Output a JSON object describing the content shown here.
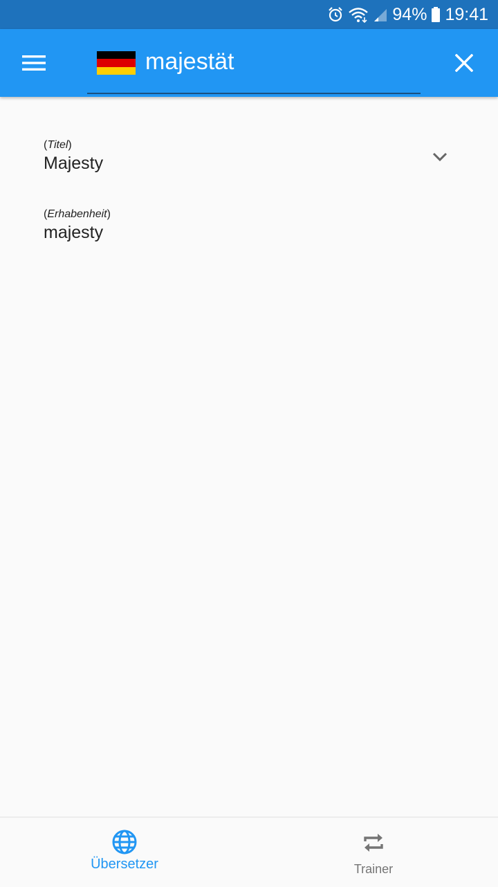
{
  "status_bar": {
    "battery_percent": "94%",
    "time": "19:41",
    "icons": [
      "alarm-icon",
      "wifi-icon",
      "signal-icon",
      "battery-icon"
    ]
  },
  "app_bar": {
    "query": "majestät",
    "language_flag": "germany-flag-icon",
    "flag_colors": [
      "#000000",
      "#dd0000",
      "#ffce00"
    ],
    "accent_color": "#2196f3"
  },
  "results": [
    {
      "context": "Titel",
      "translation": "Majesty"
    },
    {
      "context": "Erhabenheit",
      "translation": "majesty"
    }
  ],
  "bottom_nav": {
    "items": [
      {
        "label": "Übersetzer",
        "icon": "globe-icon",
        "active": true
      },
      {
        "label": "Trainer",
        "icon": "repeat-icon",
        "active": false
      }
    ]
  }
}
